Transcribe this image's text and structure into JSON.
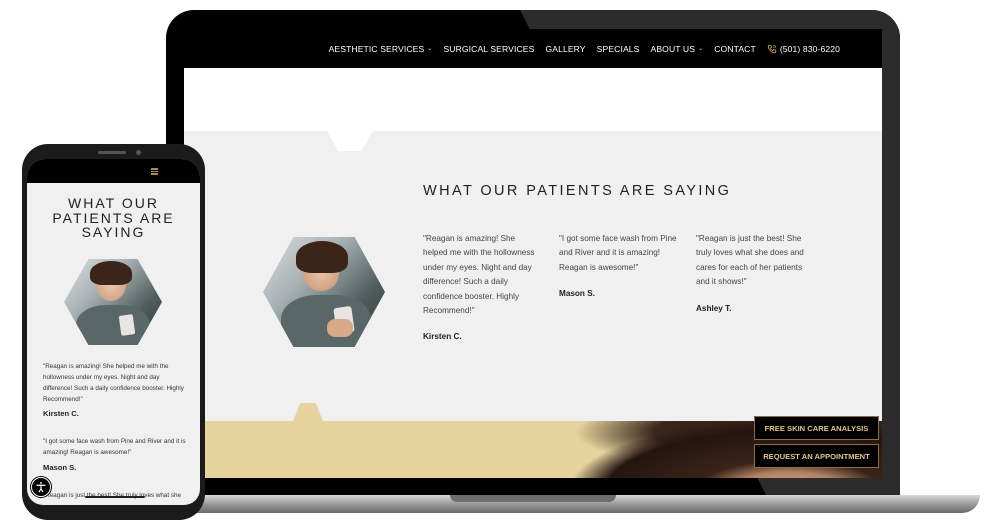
{
  "laptop": {
    "nav": {
      "items": [
        {
          "label": "AESTHETIC SERVICES",
          "has_dropdown": true
        },
        {
          "label": "SURGICAL SERVICES",
          "has_dropdown": false
        },
        {
          "label": "GALLERY",
          "has_dropdown": false
        },
        {
          "label": "SPECIALS",
          "has_dropdown": false
        },
        {
          "label": "ABOUT US",
          "has_dropdown": true
        },
        {
          "label": "CONTACT",
          "has_dropdown": false
        }
      ],
      "phone": "(501) 830-6220",
      "chevron": "⌄"
    },
    "section_title": "WHAT OUR PATIENTS ARE SAYING",
    "testimonials": [
      {
        "quote": "\"Reagan is amazing! She helped me with the hollowness under my eyes. Night and day difference! Such a daily confidence booster. Highly Recommend!\"",
        "author": "Kirsten C."
      },
      {
        "quote": "\"I got some face wash from Pine and River and it is amazing! Reagan is awesome!\"",
        "author": "Mason S."
      },
      {
        "quote": "\"Reagan is just the best! She truly loves what she does and cares for each of her patients and it shows!\"",
        "author": "Ashley T."
      }
    ],
    "cta_buttons": [
      {
        "label": "FREE SKIN CARE ANALYSIS"
      },
      {
        "label": "REQUEST AN APPOINTMENT"
      }
    ]
  },
  "mobile": {
    "title_lines": [
      "WHAT OUR",
      "PATIENTS ARE",
      "SAYING"
    ],
    "testimonials": [
      {
        "quote": "\"Reagan is amazing! She helped me with the hollowness under my eyes. Night and day difference! Such a daily confidence booster. Highly Recommend!\"",
        "author": "Kirsten C."
      },
      {
        "quote": "\"I got some face wash from Pine and River and it is amazing! Reagan is awesome!\"",
        "author": "Mason S."
      },
      {
        "quote": "\"Reagan is just the best! She truly loves what she"
      }
    ]
  },
  "colors": {
    "gold_accent": "#e2c58a",
    "gold_band": "#e6d39e",
    "nav_bg": "#000000",
    "section_bg": "#f0f0f0"
  }
}
